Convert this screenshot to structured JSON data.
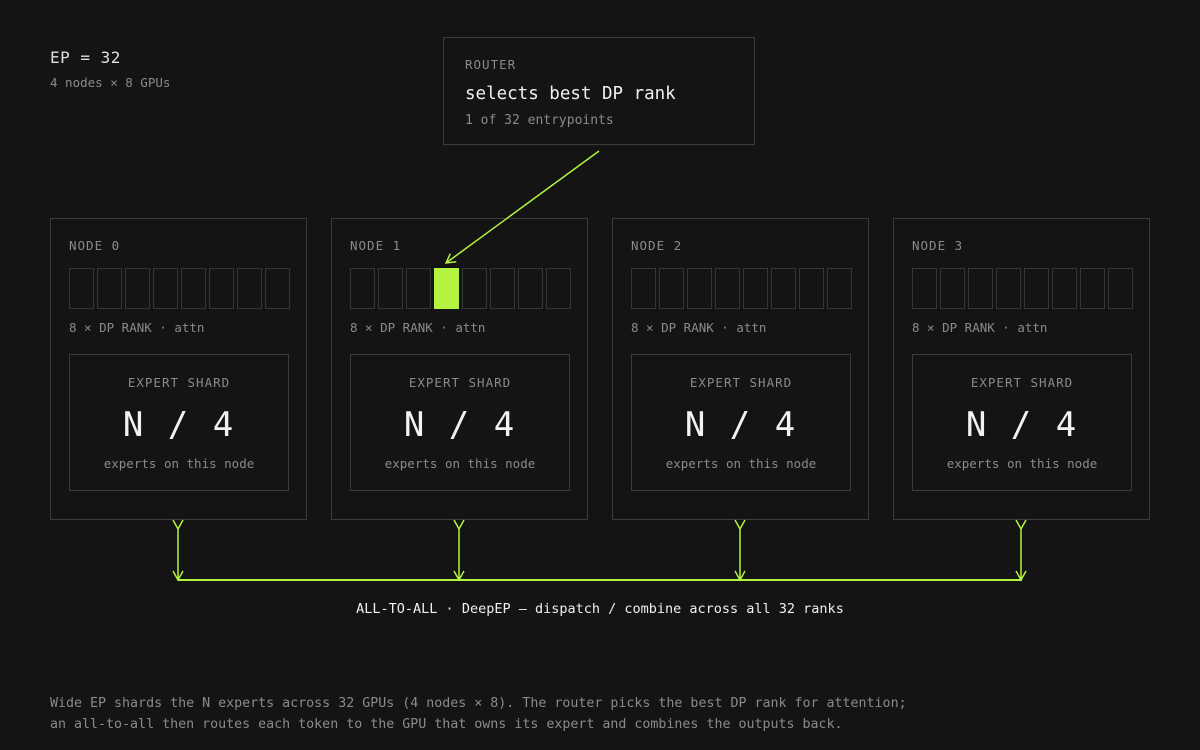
{
  "ep": {
    "title": "EP = 32",
    "subtitle": "4 nodes × 8 GPUs"
  },
  "router": {
    "label": "ROUTER",
    "title": "selects best DP rank",
    "subtitle": "1 of 32 entrypoints"
  },
  "nodes": [
    {
      "label": "NODE 0",
      "gpu_count": 8,
      "active_gpu": null,
      "dp_label": "8 × DP RANK · attn",
      "shard": {
        "label": "EXPERT SHARD",
        "value": "N / 4",
        "sub": "experts on this node"
      }
    },
    {
      "label": "NODE 1",
      "gpu_count": 8,
      "active_gpu": 3,
      "dp_label": "8 × DP RANK · attn",
      "shard": {
        "label": "EXPERT SHARD",
        "value": "N / 4",
        "sub": "experts on this node"
      }
    },
    {
      "label": "NODE 2",
      "gpu_count": 8,
      "active_gpu": null,
      "dp_label": "8 × DP RANK · attn",
      "shard": {
        "label": "EXPERT SHARD",
        "value": "N / 4",
        "sub": "experts on this node"
      }
    },
    {
      "label": "NODE 3",
      "gpu_count": 8,
      "active_gpu": null,
      "dp_label": "8 × DP RANK · attn",
      "shard": {
        "label": "EXPERT SHARD",
        "value": "N / 4",
        "sub": "experts on this node"
      }
    }
  ],
  "all_to_all": {
    "label": "ALL-TO-ALL · DeepEP — dispatch / combine across all 32 ranks"
  },
  "caption": {
    "line1": "Wide EP shards the N experts across 32 GPUs (4 nodes × 8). The router picks the best DP rank for attention;",
    "line2": "an all-to-all then routes each token to the GPU that owns its expert and combines the outputs back."
  },
  "colors": {
    "accent": "#b4f33f",
    "background": "#141414",
    "border": "#3c3c3c"
  }
}
